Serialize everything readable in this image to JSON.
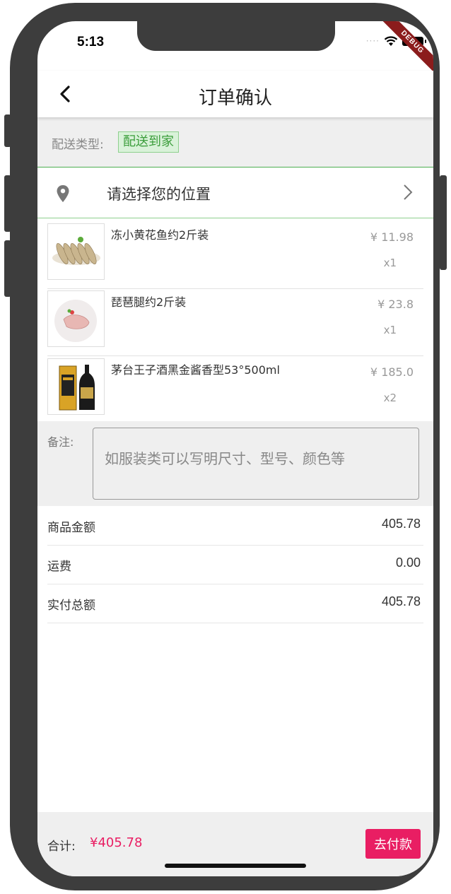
{
  "status_bar": {
    "time": "5:13",
    "dots": "····",
    "debug": "DEBUG"
  },
  "appbar": {
    "title": "订单确认"
  },
  "delivery": {
    "label": "配送类型:",
    "value": "配送到家"
  },
  "location": {
    "text": "请选择您的位置"
  },
  "products": [
    {
      "name": "冻小黄花鱼约2斤装",
      "price": "¥ 11.98",
      "qty": "x1",
      "image": "yellow-croaker-fish"
    },
    {
      "name": "琵琶腿约2斤装",
      "price": "¥ 23.8",
      "qty": "x1",
      "image": "chicken-drumstick-plate"
    },
    {
      "name": "茅台王子酒黑金酱香型53°500ml",
      "price": "¥ 185.0",
      "qty": "x2",
      "image": "maotai-liquor-bottle"
    }
  ],
  "notes": {
    "label": "备注:",
    "placeholder": "如服装类可以写明尺寸、型号、颜色等"
  },
  "summary": [
    {
      "label": "商品金额",
      "value": "405.78"
    },
    {
      "label": "运费",
      "value": "0.00"
    },
    {
      "label": "实付总额",
      "value": "405.78"
    }
  ],
  "bottom": {
    "total_label": "合计:",
    "total_value": "¥405.78",
    "pay_label": "去付款"
  },
  "colors": {
    "accent_pink": "#e91e63",
    "accent_green": "#4caf50",
    "frame": "#3d3d3d"
  }
}
